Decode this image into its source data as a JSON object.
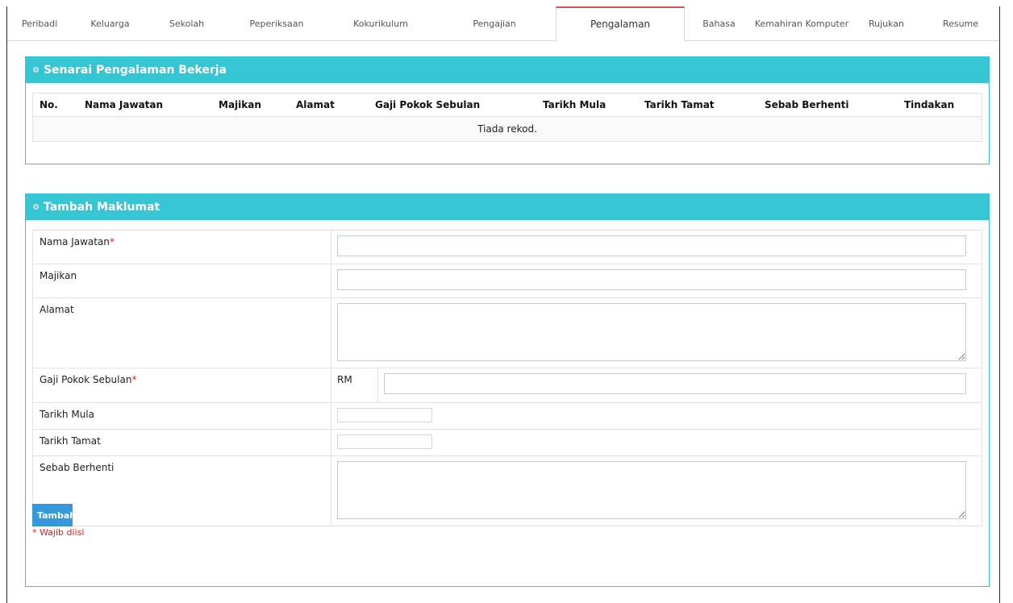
{
  "tabs": [
    {
      "label": "Peribadi"
    },
    {
      "label": "Keluarga"
    },
    {
      "label": "Sekolah"
    },
    {
      "label": "Peperiksaan"
    },
    {
      "label": "Kokurikulum"
    },
    {
      "label": "Pengajian"
    },
    {
      "label": "Pengalaman"
    },
    {
      "label": "Bahasa"
    },
    {
      "label": "Kemahiran Komputer"
    },
    {
      "label": "Rujukan"
    },
    {
      "label": "Resume"
    }
  ],
  "active_tab": "Pengalaman",
  "list_panel": {
    "title": "Senarai Pengalaman Bekerja",
    "columns": [
      "No.",
      "Nama Jawatan",
      "Majikan",
      "Alamat",
      "Gaji Pokok Sebulan",
      "Tarikh Mula",
      "Tarikh Tamat",
      "Sebab Berhenti",
      "Tindakan"
    ],
    "empty_text": "Tiada rekod."
  },
  "form_panel": {
    "title": "Tambah Maklumat",
    "fields": {
      "nama_jawatan": {
        "label": "Nama Jawatan",
        "required": "*",
        "value": ""
      },
      "majikan": {
        "label": "Majikan",
        "value": ""
      },
      "alamat": {
        "label": "Alamat",
        "value": ""
      },
      "gaji": {
        "label": "Gaji Pokok Sebulan",
        "required": "*",
        "prefix": "RM",
        "value": ""
      },
      "tarikh_mula": {
        "label": "Tarikh Mula",
        "value": ""
      },
      "tarikh_tamat": {
        "label": "Tarikh Tamat",
        "value": ""
      },
      "sebab_berhenti": {
        "label": "Sebab Berhenti",
        "value": ""
      }
    },
    "submit_label": "Tambah",
    "required_note": "* Wajib diisi"
  },
  "colors": {
    "panel_header": "#36c6d3",
    "button": "#3598dc",
    "required": "#e02222",
    "active_tab_accent": "#d9534f"
  }
}
